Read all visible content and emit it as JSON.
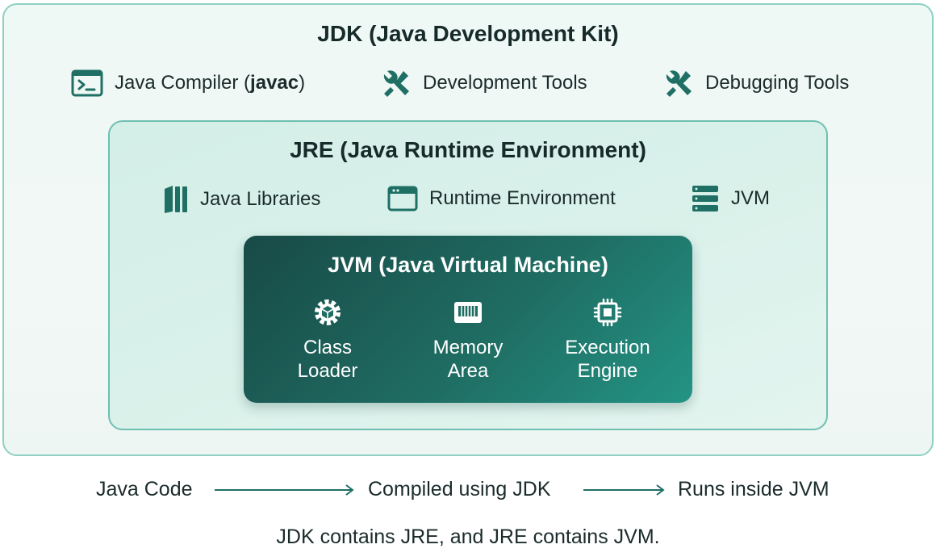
{
  "jdk": {
    "title": "JDK (Java Development Kit)",
    "items": [
      {
        "label_prefix": "Java Compiler (",
        "label_bold": "javac",
        "label_suffix": ")",
        "icon": "terminal-icon"
      },
      {
        "label": "Development Tools",
        "icon": "tools-icon"
      },
      {
        "label": "Debugging Tools",
        "icon": "tools-icon"
      }
    ]
  },
  "jre": {
    "title": "JRE (Java Runtime Environment)",
    "items": [
      {
        "label": "Java Libraries",
        "icon": "books-icon"
      },
      {
        "label": "Runtime Environment",
        "icon": "window-icon"
      },
      {
        "label": "JVM",
        "icon": "server-icon"
      }
    ]
  },
  "jvm": {
    "title": "JVM (Java Virtual Machine)",
    "components": [
      {
        "line1": "Class",
        "line2": "Loader",
        "icon": "cube-gear-icon"
      },
      {
        "line1": "Memory",
        "line2": "Area",
        "icon": "memory-icon"
      },
      {
        "line1": "Execution",
        "line2": "Engine",
        "icon": "chip-icon"
      }
    ]
  },
  "flow": {
    "steps": [
      "Java Code",
      "Compiled using JDK",
      "Runs inside JVM"
    ]
  },
  "footer": "JDK contains JRE, and JRE contains JVM.",
  "colors": {
    "accent": "#1f6f65",
    "jdk_border": "#8fd0c3",
    "jre_border": "#6fbfb0",
    "jvm_dark": "#184a47",
    "jvm_light": "#239484"
  }
}
